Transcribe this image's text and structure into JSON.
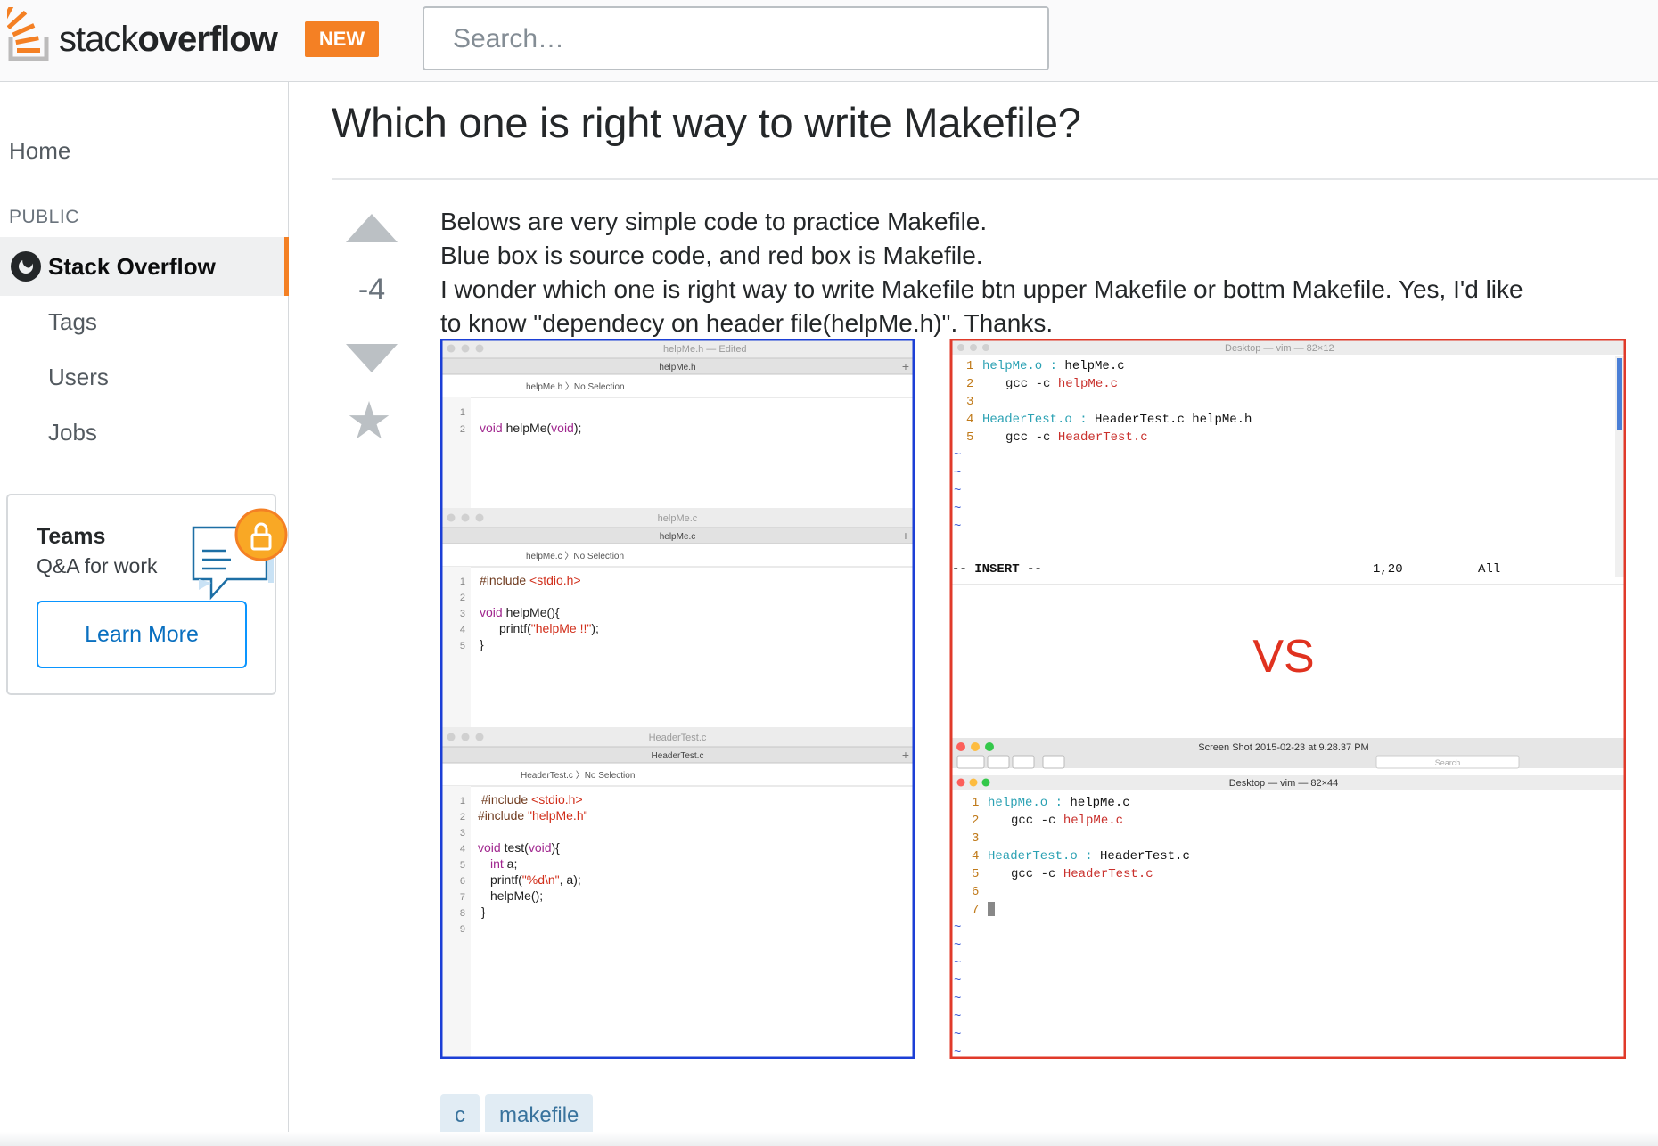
{
  "header": {
    "logo_text_light": "stack",
    "logo_text_bold": "overflow",
    "new_badge": "NEW",
    "search_placeholder": "Search…"
  },
  "sidebar": {
    "home": "Home",
    "public_label": "PUBLIC",
    "stack_overflow": "Stack Overflow",
    "tags": "Tags",
    "users": "Users",
    "jobs": "Jobs",
    "teams_title": "Teams",
    "teams_subtitle": "Q&A for work",
    "learn_more": "Learn More"
  },
  "question": {
    "title": "Which one is right way to write Makefile?",
    "vote_count": "-4",
    "body_lines": [
      "Belows are very simple code to practice Makefile.",
      "Blue box is source code, and red box is Makefile.",
      "I wonder which one is right way to write Makefile btn upper Makefile or bottm Makefile. Yes, I'd like",
      "to know \"dependecy on header file(helpMe.h)\". Thanks."
    ],
    "tags": [
      "c",
      "makefile"
    ]
  },
  "screenshot": {
    "left_panes": [
      {
        "window_title": "helpMe.h — Edited",
        "tab": "helpMe.h",
        "jumpbar": "helpMe.h 〉No Selection",
        "lines": [
          "",
          "void helpMe(void);"
        ]
      },
      {
        "window_title": "helpMe.c",
        "tab": "helpMe.c",
        "jumpbar": "helpMe.c 〉No Selection",
        "lines": [
          "#include <stdio.h>",
          "",
          "void helpMe(){",
          "    printf(\"helpMe !!\");",
          "}"
        ]
      },
      {
        "window_title": "HeaderTest.c",
        "tab": "HeaderTest.c",
        "jumpbar": "HeaderTest.c 〉No Selection",
        "lines": [
          " #include <stdio.h>",
          "#include \"helpMe.h\"",
          "",
          "void test(void){",
          "   int a;",
          "   printf(\"%d\\n\", a);",
          "   helpMe();",
          " }",
          ""
        ]
      }
    ],
    "vim_top": {
      "window_title": "Desktop — vim — 82×12",
      "lines": [
        {
          "num": "1",
          "target": "helpMe.o",
          "deps": "helpMe.c"
        },
        {
          "num": "2",
          "cmd": "gcc -c",
          "file": "helpMe.c"
        },
        {
          "num": "3"
        },
        {
          "num": "4",
          "target": "HeaderTest.o",
          "deps": "HeaderTest.c helpMe.h"
        },
        {
          "num": "5",
          "cmd": "gcc -c ",
          "file": "HeaderTest.c"
        }
      ],
      "mode": "-- INSERT --",
      "position": "1,20",
      "scroll": "All"
    },
    "vs_label": "VS",
    "preview_title": "Screen Shot 2015-02-23 at 9.28.37 PM",
    "preview_search": "Search",
    "vim_bottom": {
      "window_title": "Desktop — vim — 82×44",
      "lines": [
        {
          "num": "1",
          "target": "helpMe.o",
          "deps": "helpMe.c"
        },
        {
          "num": "2",
          "cmd": "gcc -c",
          "file": "helpMe.c"
        },
        {
          "num": "3"
        },
        {
          "num": "4",
          "target": "HeaderTest.o",
          "deps": "HeaderTest.c"
        },
        {
          "num": "5",
          "cmd": "gcc -c ",
          "file": "HeaderTest.c"
        },
        {
          "num": "6"
        },
        {
          "num": "7"
        }
      ]
    }
  },
  "colors": {
    "accent": "#f48024",
    "blue_box": "#1c3fd6",
    "red_box": "#e03a2a",
    "vim_cyan": "#2aa1b3",
    "vim_red": "#c9302c",
    "code_purple": "#a0268e",
    "code_red": "#d12f1b"
  }
}
